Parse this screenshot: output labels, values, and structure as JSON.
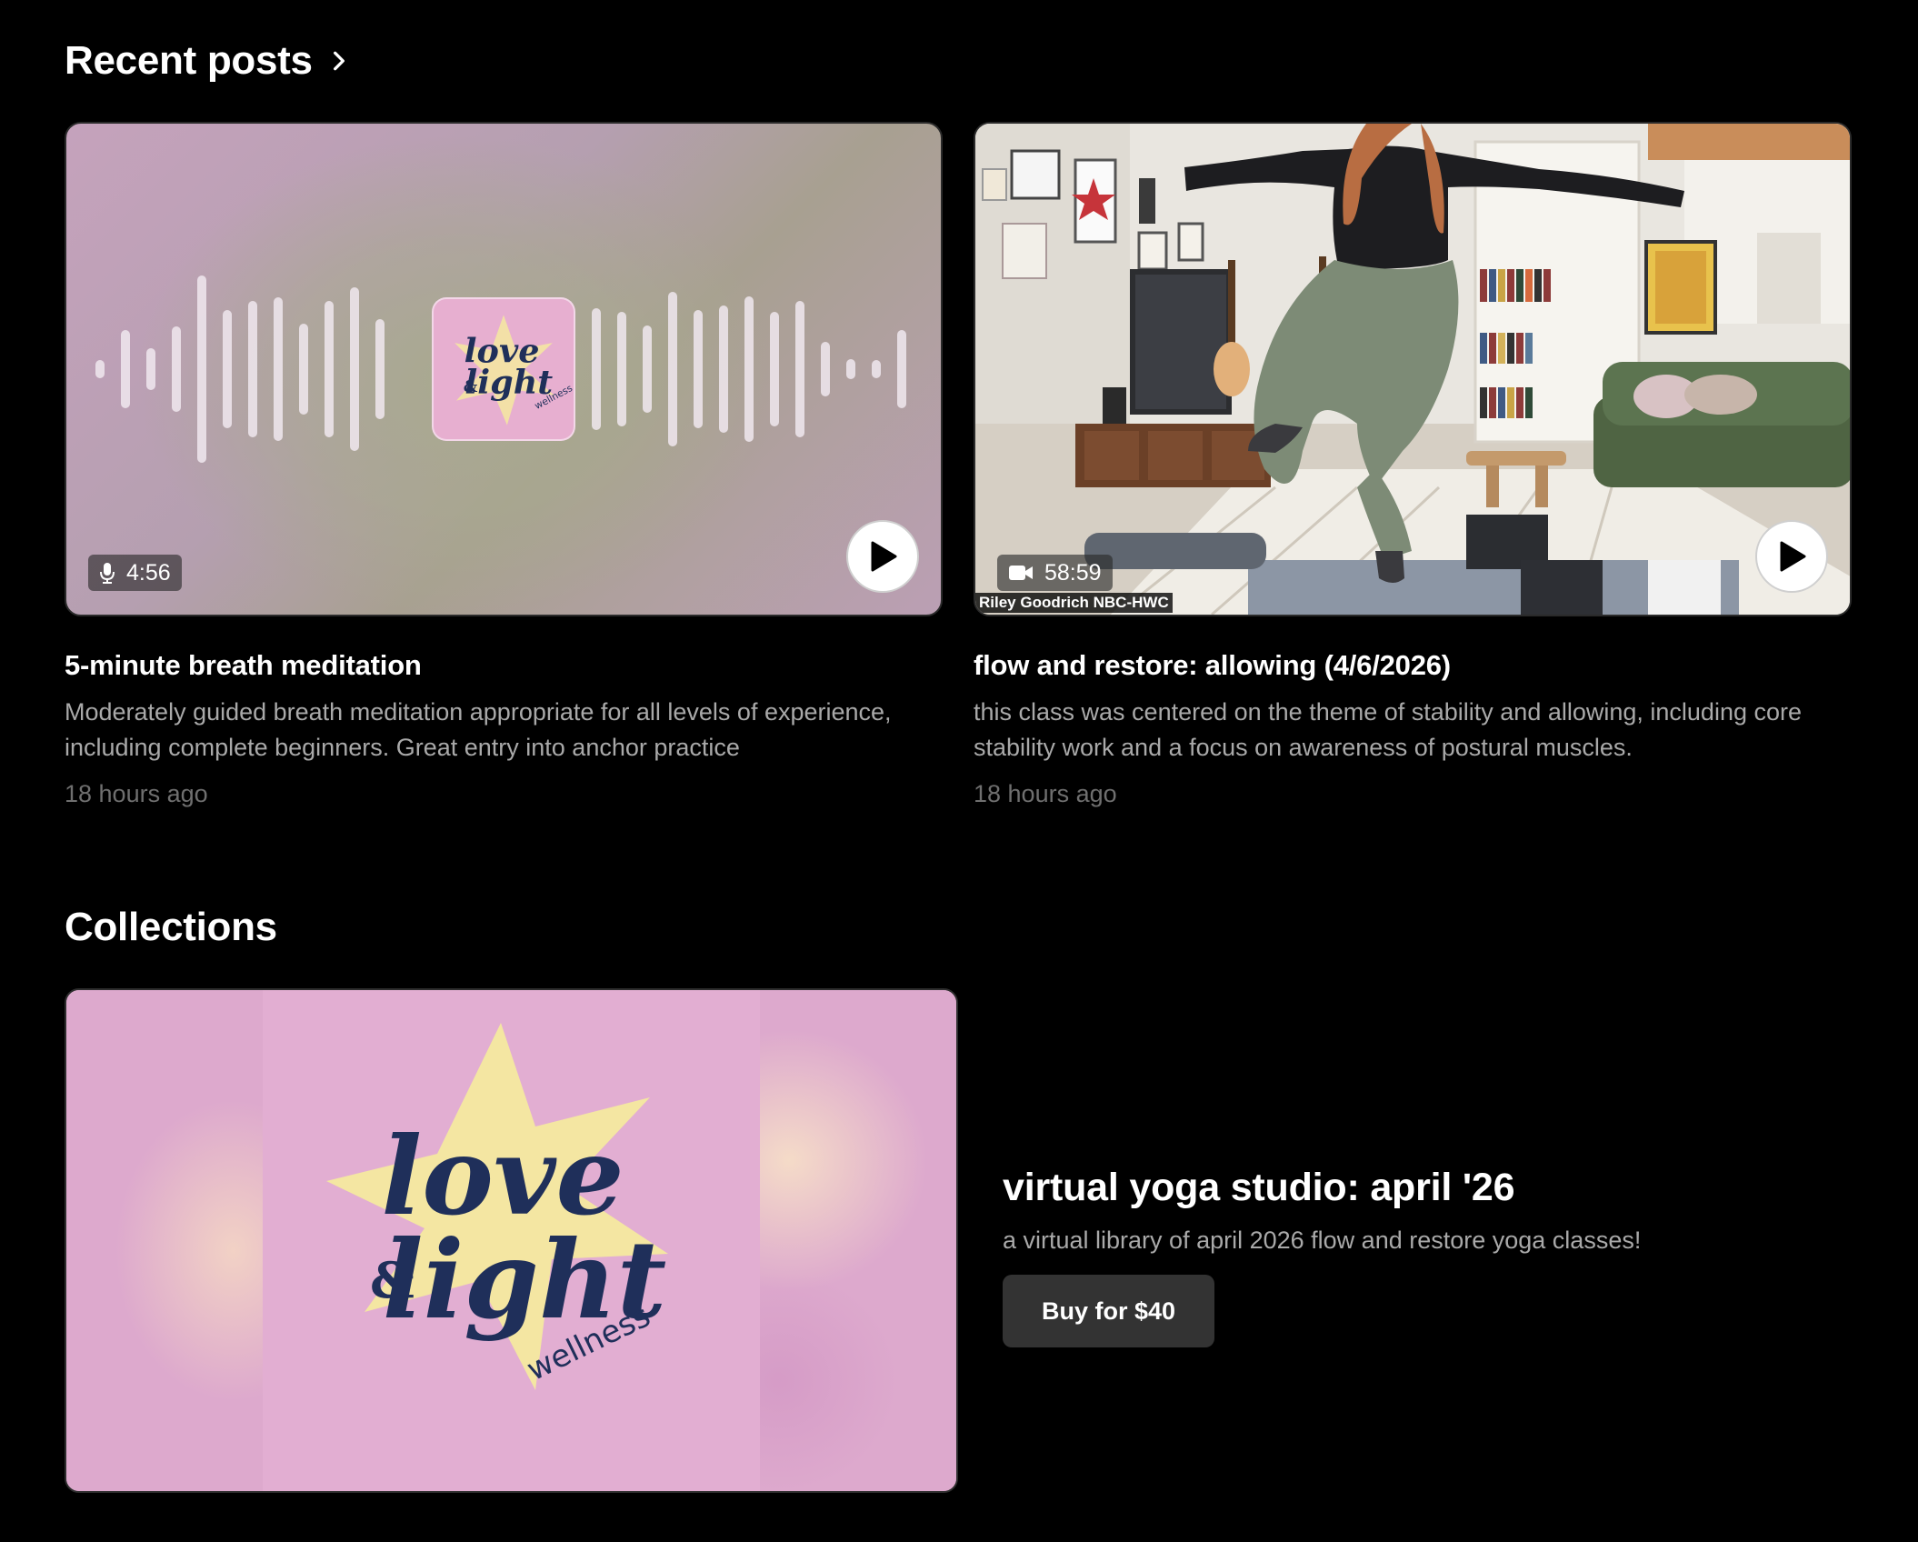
{
  "recent_posts": {
    "title": "Recent posts",
    "posts": [
      {
        "type": "audio",
        "media_icon": "microphone-icon",
        "duration": "4:56",
        "title": "5-minute breath meditation",
        "description": "Moderately guided breath meditation appropriate for all levels of experience, including complete beginners. Great entry into anchor practice",
        "posted": "18 hours ago"
      },
      {
        "type": "video",
        "media_icon": "video-camera-icon",
        "duration": "58:59",
        "caption": "Riley Goodrich NBC-HWC",
        "title": "flow and restore: allowing (4/6/2026)",
        "description": "this class was centered on the theme of stability and allowing, including core stability work and a focus on awareness of postural muscles.",
        "posted": "18 hours ago"
      }
    ]
  },
  "collections": {
    "title": "Collections",
    "items": [
      {
        "title": "virtual yoga studio: april '26",
        "description": "a virtual library of april 2026 flow and restore yoga classes!",
        "buy_label": "Buy for $40"
      }
    ]
  },
  "logo": {
    "line1": "love",
    "amp": "&",
    "line2": "light",
    "sub": "wellness",
    "colors": {
      "background": "#e2aed2",
      "star": "#f4e6a2",
      "ink": "#1f2f5a"
    }
  },
  "colors": {
    "page_background": "#000000",
    "title_text": "#ffffff",
    "description_text": "#a9a9a9",
    "time_text": "#6f6f6f",
    "button_background": "#333333"
  }
}
